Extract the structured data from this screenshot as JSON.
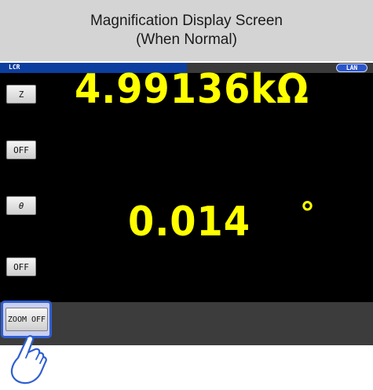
{
  "caption": {
    "line1": "Magnification Display Screen",
    "line2": "(When Normal)"
  },
  "screen": {
    "mode_label": "LCR",
    "network_badge": "LAN",
    "buttons": {
      "param1": "Z",
      "param1_off": "OFF",
      "param2": "θ",
      "param2_off": "OFF",
      "zoom": "ZOOM OFF"
    },
    "readings": {
      "z_value": "4.99136kΩ",
      "theta_value": "0.014",
      "theta_unit": "°"
    }
  },
  "colors": {
    "caption_bg": "#d4d4d4",
    "screen_bg": "#000000",
    "reading": "#ffff00",
    "mode_bar": "#0c3ea0",
    "highlight": "#2f5fd0"
  },
  "icons": {
    "pointer": "pointing-hand-icon"
  }
}
